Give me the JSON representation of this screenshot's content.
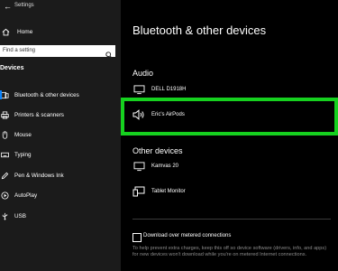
{
  "window": {
    "title": "Settings",
    "back_glyph": "←",
    "controls": [
      "—",
      "☐",
      "✕"
    ]
  },
  "sidebar": {
    "home": "Home",
    "search_placeholder": "Find a setting",
    "section": "Devices",
    "items": [
      {
        "label": "Bluetooth & other devices",
        "icon": "bluetooth-icon"
      },
      {
        "label": "Printers & scanners",
        "icon": "printer-icon"
      },
      {
        "label": "Mouse",
        "icon": "mouse-icon"
      },
      {
        "label": "Typing",
        "icon": "keyboard-icon"
      },
      {
        "label": "Pen & Windows Ink",
        "icon": "pen-icon"
      },
      {
        "label": "AutoPlay",
        "icon": "autoplay-icon"
      },
      {
        "label": "USB",
        "icon": "usb-icon"
      }
    ]
  },
  "main": {
    "title": "Bluetooth & other devices",
    "audio_heading": "Audio",
    "audio_devices": [
      {
        "name": "DELL D1918H",
        "icon": "monitor-icon"
      },
      {
        "name": "Eric's AirPods",
        "icon": "speaker-icon"
      }
    ],
    "other_heading": "Other devices",
    "other_devices": [
      {
        "name": "Kamvas 20",
        "icon": "monitor-icon"
      },
      {
        "name": "Tablet Monitor",
        "icon": "tablet-monitor-icon"
      }
    ],
    "metered_label": "Download over metered connections",
    "metered_note": "To help prevent extra charges, keep this off so device software (drivers, info, and apps) for new devices won't download while you're on metered Internet connections."
  },
  "colors": {
    "highlight": "#16d11f",
    "sidebar_bg": "#1b1b1b",
    "accent": "#0a84ff"
  }
}
